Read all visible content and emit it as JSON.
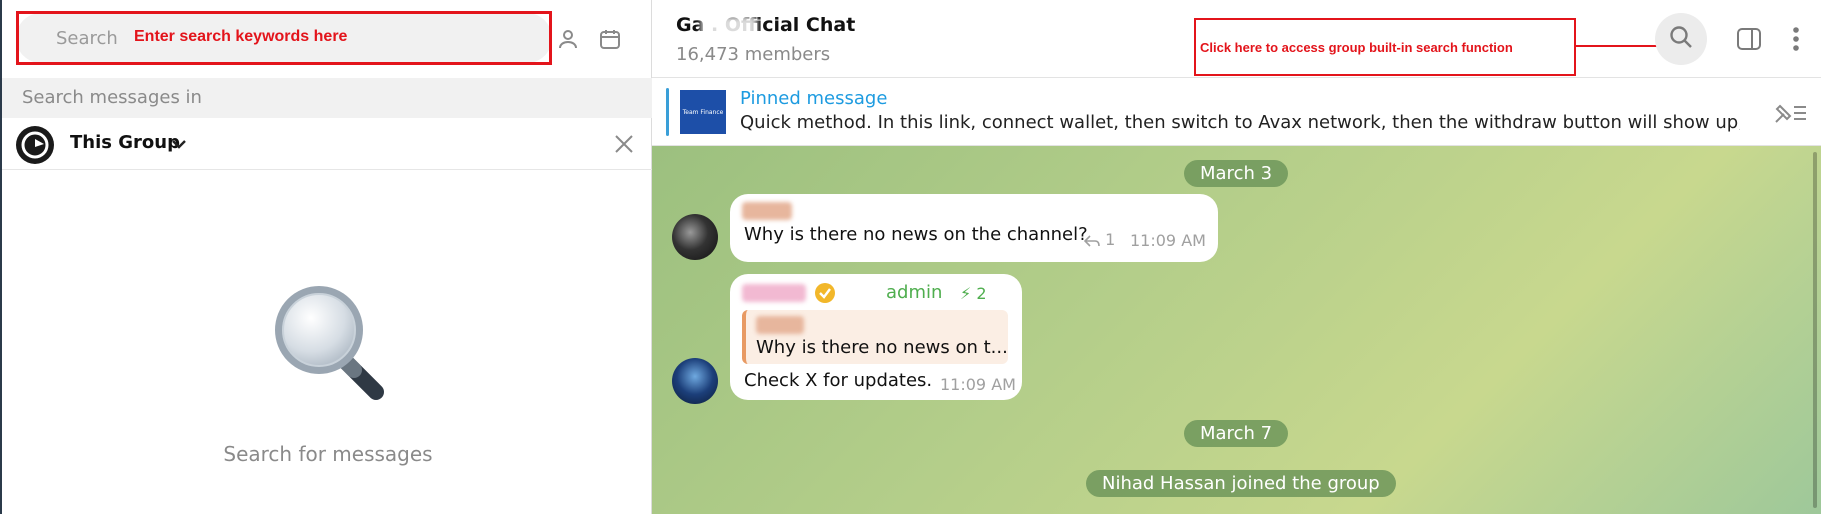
{
  "search": {
    "placeholder": "Search",
    "annotation": "Enter search keywords here"
  },
  "left_panel": {
    "search_in_label": "Search messages in",
    "scope": {
      "label": "This Group"
    },
    "empty_state": {
      "text": "Search for messages"
    }
  },
  "chat_header": {
    "title": "Ga    .    Official Chat",
    "members": "16,473 members",
    "annotation": "Click here to access group built-in search function"
  },
  "pinned": {
    "title": "Pinned message",
    "thumb_label": "Team Finance",
    "text": "Quick method.  In this link, connect wallet, then switch to Avax network, then the withdraw button will show up, belo..."
  },
  "messages": [
    {
      "date": "March 3"
    },
    {
      "sender": "Masja",
      "text": "Why is there no news on the channel?",
      "replies": "1",
      "time": "11:09 AM"
    },
    {
      "sender": "",
      "role": "admin",
      "boosts": "2",
      "reply_to": {
        "sender": "Masja",
        "text": "Why is there no news on t..."
      },
      "text": "Check X for updates.",
      "time": "11:09 AM"
    },
    {
      "date": "March 7"
    },
    {
      "service": "Nihad Hassan joined the group"
    }
  ],
  "colors": {
    "annotation_red": "#e3141b",
    "accent_blue": "#1d9be0",
    "admin_green": "#4fae4e"
  }
}
